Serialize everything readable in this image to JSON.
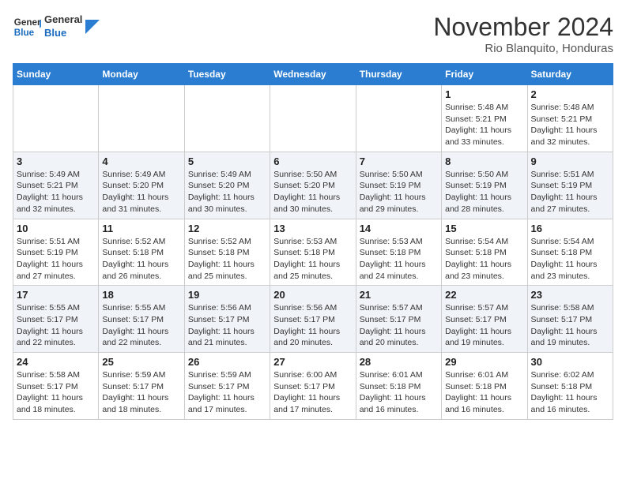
{
  "logo": {
    "line1": "General",
    "line2": "Blue"
  },
  "title": "November 2024",
  "location": "Rio Blanquito, Honduras",
  "weekdays": [
    "Sunday",
    "Monday",
    "Tuesday",
    "Wednesday",
    "Thursday",
    "Friday",
    "Saturday"
  ],
  "weeks": [
    [
      {
        "day": "",
        "info": ""
      },
      {
        "day": "",
        "info": ""
      },
      {
        "day": "",
        "info": ""
      },
      {
        "day": "",
        "info": ""
      },
      {
        "day": "",
        "info": ""
      },
      {
        "day": "1",
        "info": "Sunrise: 5:48 AM\nSunset: 5:21 PM\nDaylight: 11 hours and 33 minutes."
      },
      {
        "day": "2",
        "info": "Sunrise: 5:48 AM\nSunset: 5:21 PM\nDaylight: 11 hours and 32 minutes."
      }
    ],
    [
      {
        "day": "3",
        "info": "Sunrise: 5:49 AM\nSunset: 5:21 PM\nDaylight: 11 hours and 32 minutes."
      },
      {
        "day": "4",
        "info": "Sunrise: 5:49 AM\nSunset: 5:20 PM\nDaylight: 11 hours and 31 minutes."
      },
      {
        "day": "5",
        "info": "Sunrise: 5:49 AM\nSunset: 5:20 PM\nDaylight: 11 hours and 30 minutes."
      },
      {
        "day": "6",
        "info": "Sunrise: 5:50 AM\nSunset: 5:20 PM\nDaylight: 11 hours and 30 minutes."
      },
      {
        "day": "7",
        "info": "Sunrise: 5:50 AM\nSunset: 5:19 PM\nDaylight: 11 hours and 29 minutes."
      },
      {
        "day": "8",
        "info": "Sunrise: 5:50 AM\nSunset: 5:19 PM\nDaylight: 11 hours and 28 minutes."
      },
      {
        "day": "9",
        "info": "Sunrise: 5:51 AM\nSunset: 5:19 PM\nDaylight: 11 hours and 27 minutes."
      }
    ],
    [
      {
        "day": "10",
        "info": "Sunrise: 5:51 AM\nSunset: 5:19 PM\nDaylight: 11 hours and 27 minutes."
      },
      {
        "day": "11",
        "info": "Sunrise: 5:52 AM\nSunset: 5:18 PM\nDaylight: 11 hours and 26 minutes."
      },
      {
        "day": "12",
        "info": "Sunrise: 5:52 AM\nSunset: 5:18 PM\nDaylight: 11 hours and 25 minutes."
      },
      {
        "day": "13",
        "info": "Sunrise: 5:53 AM\nSunset: 5:18 PM\nDaylight: 11 hours and 25 minutes."
      },
      {
        "day": "14",
        "info": "Sunrise: 5:53 AM\nSunset: 5:18 PM\nDaylight: 11 hours and 24 minutes."
      },
      {
        "day": "15",
        "info": "Sunrise: 5:54 AM\nSunset: 5:18 PM\nDaylight: 11 hours and 23 minutes."
      },
      {
        "day": "16",
        "info": "Sunrise: 5:54 AM\nSunset: 5:18 PM\nDaylight: 11 hours and 23 minutes."
      }
    ],
    [
      {
        "day": "17",
        "info": "Sunrise: 5:55 AM\nSunset: 5:17 PM\nDaylight: 11 hours and 22 minutes."
      },
      {
        "day": "18",
        "info": "Sunrise: 5:55 AM\nSunset: 5:17 PM\nDaylight: 11 hours and 22 minutes."
      },
      {
        "day": "19",
        "info": "Sunrise: 5:56 AM\nSunset: 5:17 PM\nDaylight: 11 hours and 21 minutes."
      },
      {
        "day": "20",
        "info": "Sunrise: 5:56 AM\nSunset: 5:17 PM\nDaylight: 11 hours and 20 minutes."
      },
      {
        "day": "21",
        "info": "Sunrise: 5:57 AM\nSunset: 5:17 PM\nDaylight: 11 hours and 20 minutes."
      },
      {
        "day": "22",
        "info": "Sunrise: 5:57 AM\nSunset: 5:17 PM\nDaylight: 11 hours and 19 minutes."
      },
      {
        "day": "23",
        "info": "Sunrise: 5:58 AM\nSunset: 5:17 PM\nDaylight: 11 hours and 19 minutes."
      }
    ],
    [
      {
        "day": "24",
        "info": "Sunrise: 5:58 AM\nSunset: 5:17 PM\nDaylight: 11 hours and 18 minutes."
      },
      {
        "day": "25",
        "info": "Sunrise: 5:59 AM\nSunset: 5:17 PM\nDaylight: 11 hours and 18 minutes."
      },
      {
        "day": "26",
        "info": "Sunrise: 5:59 AM\nSunset: 5:17 PM\nDaylight: 11 hours and 17 minutes."
      },
      {
        "day": "27",
        "info": "Sunrise: 6:00 AM\nSunset: 5:17 PM\nDaylight: 11 hours and 17 minutes."
      },
      {
        "day": "28",
        "info": "Sunrise: 6:01 AM\nSunset: 5:18 PM\nDaylight: 11 hours and 16 minutes."
      },
      {
        "day": "29",
        "info": "Sunrise: 6:01 AM\nSunset: 5:18 PM\nDaylight: 11 hours and 16 minutes."
      },
      {
        "day": "30",
        "info": "Sunrise: 6:02 AM\nSunset: 5:18 PM\nDaylight: 11 hours and 16 minutes."
      }
    ]
  ]
}
